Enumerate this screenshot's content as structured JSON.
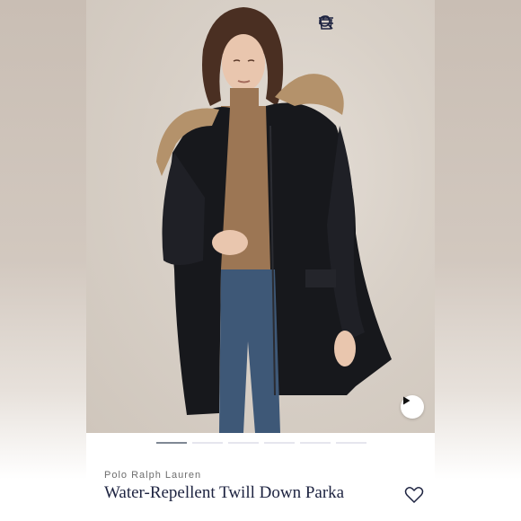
{
  "header": {
    "icons": [
      "search-icon",
      "shopping-bag-icon",
      "menu-icon"
    ]
  },
  "gallery": {
    "image_count": 6,
    "active_index": 0,
    "video_icon": "play-icon"
  },
  "product": {
    "brand": "Polo Ralph Lauren",
    "title": "Water-Repellent Twill Down Parka"
  },
  "colors": {
    "navy_text": "#1d2340",
    "jacket": "#17181c",
    "fur": "#b4926b",
    "turtleneck": "#9c7654",
    "jeans": "#3e5877"
  }
}
